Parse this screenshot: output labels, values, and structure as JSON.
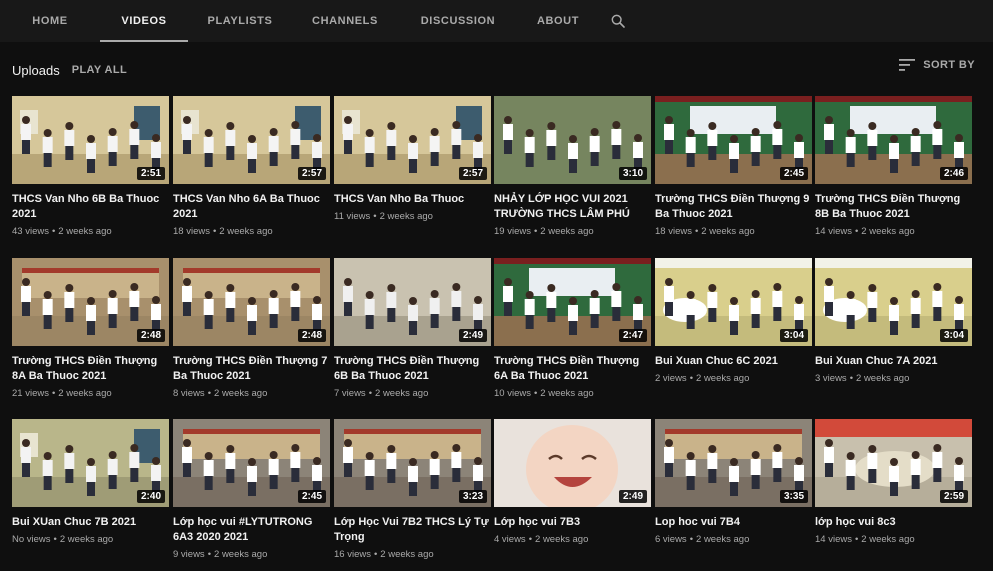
{
  "tabs": [
    {
      "label": "HOME",
      "active": false
    },
    {
      "label": "VIDEOS",
      "active": true
    },
    {
      "label": "PLAYLISTS",
      "active": false
    },
    {
      "label": "CHANNELS",
      "active": false
    },
    {
      "label": "DISCUSSION",
      "active": false
    },
    {
      "label": "ABOUT",
      "active": false
    }
  ],
  "subbar": {
    "uploads": "Uploads",
    "play_all": "PLAY ALL",
    "sort_by": "SORT BY"
  },
  "videos": [
    {
      "title": "THCS Van Nho 6B Ba Thuoc 2021",
      "views": "43 views",
      "age": "2 weeks ago",
      "duration": "2:51",
      "scene": "classroom"
    },
    {
      "title": "THCS Van Nho 6A Ba Thuoc 2021",
      "views": "18 views",
      "age": "2 weeks ago",
      "duration": "2:57",
      "scene": "classroom"
    },
    {
      "title": "THCS Van Nho Ba Thuoc",
      "views": "11 views",
      "age": "2 weeks ago",
      "duration": "2:57",
      "scene": "classroom"
    },
    {
      "title": "NHẢY LỚP HỌC VUI 2021 TRƯỜNG THCS LÂM PHÚ",
      "views": "19 views",
      "age": "2 weeks ago",
      "duration": "3:10",
      "scene": "field"
    },
    {
      "title": "Trường THCS Điền Thượng 9 Ba Thuoc 2021",
      "views": "18 views",
      "age": "2 weeks ago",
      "duration": "2:45",
      "scene": "stage"
    },
    {
      "title": "Trường THCS Điền Thượng 8B Ba Thuoc 2021",
      "views": "14 views",
      "age": "2 weeks ago",
      "duration": "2:46",
      "scene": "stage"
    },
    {
      "title": "Trường THCS Điền Thượng 8A Ba Thuoc 2021",
      "views": "21 views",
      "age": "2 weeks ago",
      "duration": "2:48",
      "scene": "yard"
    },
    {
      "title": "Trường THCS Điền Thượng 7 Ba Thuoc 2021",
      "views": "8 views",
      "age": "2 weeks ago",
      "duration": "2:48",
      "scene": "yard"
    },
    {
      "title": "Trường THCS Điền Thượng 6B Ba Thuoc 2021",
      "views": "7 views",
      "age": "2 weeks ago",
      "duration": "2:49",
      "scene": "dance"
    },
    {
      "title": "Trường THCS Điền Thượng 6A Ba Thuoc 2021",
      "views": "10 views",
      "age": "2 weeks ago",
      "duration": "2:47",
      "scene": "stage"
    },
    {
      "title": "Bui Xuan Chuc 6C 2021",
      "views": "2 views",
      "age": "2 weeks ago",
      "duration": "3:04",
      "scene": "sign"
    },
    {
      "title": "Bui Xuan Chuc 7A 2021",
      "views": "3 views",
      "age": "2 weeks ago",
      "duration": "3:04",
      "scene": "sign"
    },
    {
      "title": "Bui XUan Chuc 7B 2021",
      "views": "No views",
      "age": "2 weeks ago",
      "duration": "2:40",
      "scene": "hall"
    },
    {
      "title": "Lớp học vui #LYTUTRONG 6A3 2020 2021",
      "views": "9 views",
      "age": "2 weeks ago",
      "duration": "2:45",
      "scene": "courtyard"
    },
    {
      "title": "Lớp Học Vui 7B2 THCS Lý Tự Trọng",
      "views": "16 views",
      "age": "2 weeks ago",
      "duration": "3:23",
      "scene": "courtyard"
    },
    {
      "title": "Lớp học vui 7B3",
      "views": "4 views",
      "age": "2 weeks ago",
      "duration": "2:49",
      "scene": "baby"
    },
    {
      "title": "Lop hoc vui 7B4",
      "views": "6 views",
      "age": "2 weeks ago",
      "duration": "3:35",
      "scene": "courtyard"
    },
    {
      "title": "lớp học vui 8c3",
      "views": "14 views",
      "age": "2 weeks ago",
      "duration": "2:59",
      "scene": "circle"
    }
  ],
  "colors": {
    "background": "#0f0f0f",
    "header": "#181818",
    "text": "#f1f1f1",
    "secondary": "#aaaaaa"
  }
}
